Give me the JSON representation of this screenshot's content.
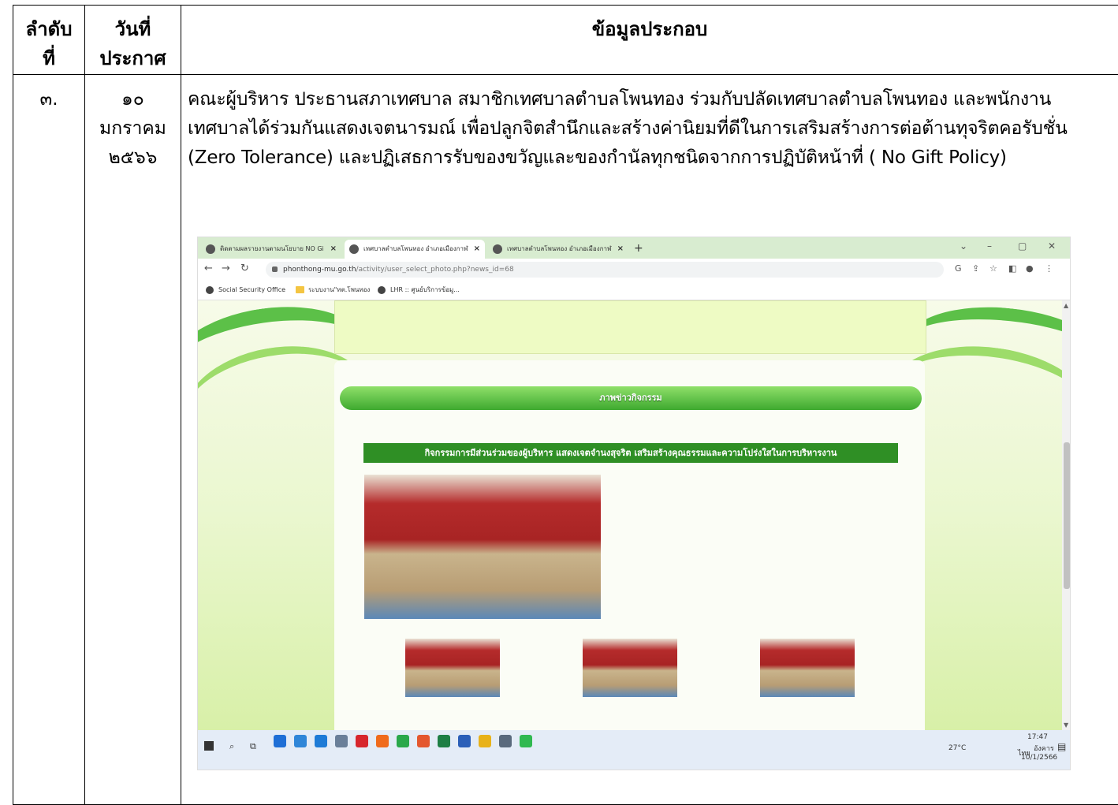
{
  "table": {
    "headers": {
      "no_line1": "ลำดับ",
      "no_line2": "ที่",
      "date_line1": "วันที่",
      "date_line2": "ประกาศ",
      "info": "ข้อมูลประกอบ"
    },
    "row": {
      "no": "๓.",
      "date_line1": "๑๐",
      "date_line2": "มกราคม",
      "date_line3": "๒๕๖๖",
      "description": "คณะผู้บริหาร  ประธานสภาเทศบาล สมาชิกเทศบาลตำบลโพนทอง ร่วมกับปลัดเทศบาลตำบลโพนทอง และพนักงานเทศบาลได้ร่วมกันแสดงเจตนารมณ์  เพื่อปลูกจิตสำนึกและสร้างค่านิยมที่ดีในการเสริมสร้างการต่อต้านทุจริตคอรับชั่น (Zero  Tolerance)  และปฏิเสธการรับของขวัญและของกำนัลทุกชนิดจากการปฏิบัติหน้าที่ ( No  Gift  Policy)"
    }
  },
  "browser": {
    "tabs": [
      {
        "label": "ติดตามผลรายงานตามนโยบาย NO Gi",
        "active": false
      },
      {
        "label": "เทศบาลตำบลโพนทอง อำเภอเมืองกาฬ",
        "active": true
      },
      {
        "label": "เทศบาลตำบลโพนทอง อำเภอเมืองกาฬ",
        "active": false
      }
    ],
    "newtab": "+",
    "url_host": "phonthong-mu.go.th",
    "url_path": "/activity/user_select_photo.php?news_id=68",
    "bookmarks": [
      "Social Security Office",
      "ระบบงาน\"ทต.โพนทอง",
      "LHR :: ศูนย์บริการข้อมู..."
    ],
    "page": {
      "section_header": "ภาพข่าวกิจกรรม",
      "activity_title": "กิจกรรมการมีส่วนร่วมของผู้บริหาร แสดงเจตจำนงสุจริต เสริมสร้างคุณธรรมและความโปร่งใสในการบริหารงาน"
    },
    "taskbar": {
      "weather": "27°C",
      "time": "17:47",
      "lang": "ไทย",
      "day": "อังคาร",
      "date": "10/1/2566"
    }
  }
}
